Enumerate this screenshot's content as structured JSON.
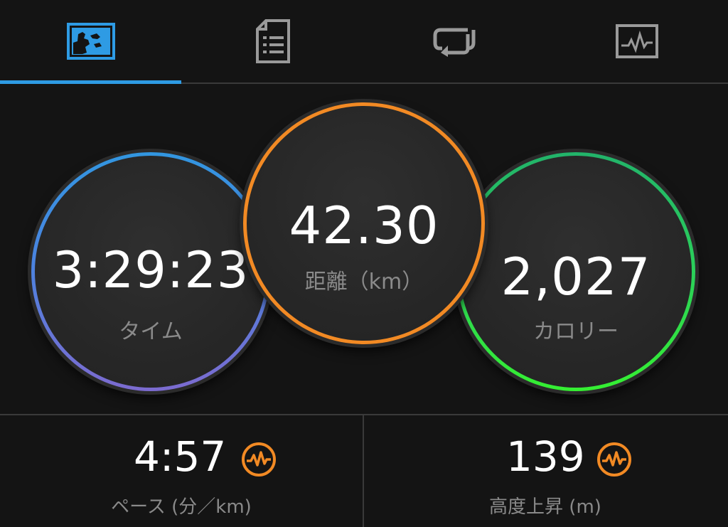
{
  "tabs": [
    {
      "icon": "activity-map-icon",
      "active": true
    },
    {
      "icon": "document-list-icon",
      "active": false
    },
    {
      "icon": "laps-loop-icon",
      "active": false
    },
    {
      "icon": "chart-graph-icon",
      "active": false
    }
  ],
  "colors": {
    "accent": "#2e9be4",
    "time_ring_top": "#3296e0",
    "time_ring_bottom": "#7c6bd0",
    "distance_ring": "#f28a24",
    "calories_ring_top": "#22b36a",
    "calories_ring_bottom": "#35ef32",
    "stat_icon": "#f28a24"
  },
  "summary": {
    "time": {
      "value": "3:29:23",
      "label": "タイム"
    },
    "distance": {
      "value": "42.30",
      "label": "距離（km）"
    },
    "calories": {
      "value": "2,027",
      "label": "カロリー"
    }
  },
  "stats": {
    "pace": {
      "value": "4:57",
      "label": "ペース (分／km)",
      "icon": "pulse-chart-icon"
    },
    "elevation": {
      "value": "139",
      "label": "高度上昇 (m)",
      "icon": "pulse-chart-icon"
    }
  }
}
